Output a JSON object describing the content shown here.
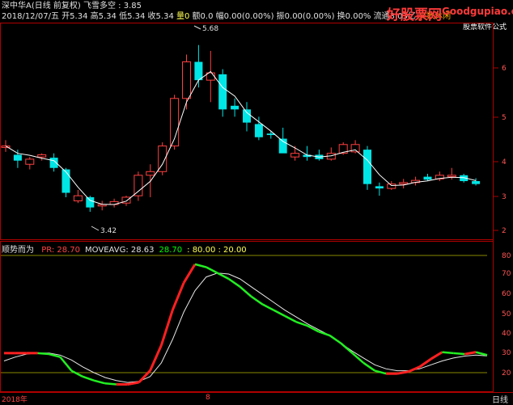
{
  "header": {
    "row1": [
      {
        "text": "深中华A(日线 前复权)",
        "cls": "c-white"
      },
      {
        "text": " 飞雪多空 : 3.85",
        "cls": "c-white"
      }
    ],
    "row2": [
      {
        "text": "2018/12/07/五 ",
        "cls": "c-white"
      },
      {
        "text": "开5.34 ",
        "cls": "c-white"
      },
      {
        "text": "高5.34 ",
        "cls": "c-white"
      },
      {
        "text": "低5.34 ",
        "cls": "c-white"
      },
      {
        "text": "收5.34 ",
        "cls": "c-white"
      },
      {
        "text": "量0 ",
        "cls": "c-yellow"
      },
      {
        "text": "额0.0 ",
        "cls": "c-white"
      },
      {
        "text": "幅0.00(0.00%) ",
        "cls": "c-white"
      },
      {
        "text": "振0.00(0.00%) ",
        "cls": "c-white"
      },
      {
        "text": "换0.00% ",
        "cls": "c-white"
      },
      {
        "text": "流通3.03亿 ",
        "cls": "c-white"
      },
      {
        "text": "文数休闲",
        "cls": "c-orange"
      }
    ]
  },
  "brand": {
    "cn": "好股票网",
    "url": "Goodgupiao.com",
    "sub": "股票软件公式"
  },
  "main_chart": {
    "high_label": "5.68",
    "low_label": "3.42",
    "right_axis": [
      "6",
      "5",
      "4",
      "3",
      "2"
    ]
  },
  "indicator": {
    "name": "顺势而为",
    "items": [
      {
        "text": "PR: 28.70",
        "cls": "c-red"
      },
      {
        "text": "MOVEAVG: 28.63",
        "cls": "c-white"
      },
      {
        "text": "28.70",
        "cls": "c-green"
      },
      {
        "text": ": 80.00 : 20.00",
        "cls": "c-yellow"
      }
    ],
    "right_axis": [
      "80",
      "70",
      "60",
      "50",
      "40",
      "30",
      "20"
    ]
  },
  "footer": {
    "date_left": "2018年",
    "date_mid": "8",
    "day_tab": "日线"
  },
  "colors": {
    "up": "#ff4040",
    "down": "#00e5e5",
    "frame": "#b00000",
    "ma": "#ffffff"
  },
  "chart_data": {
    "type": "candlestick",
    "candles": [
      {
        "o": 4.28,
        "h": 4.38,
        "l": 4.22,
        "c": 4.3,
        "d": false
      },
      {
        "o": 4.18,
        "h": 4.25,
        "l": 4.0,
        "c": 4.1,
        "d": true
      },
      {
        "o": 4.05,
        "h": 4.15,
        "l": 3.98,
        "c": 4.12,
        "d": false
      },
      {
        "o": 4.15,
        "h": 4.2,
        "l": 4.1,
        "c": 4.18,
        "d": false
      },
      {
        "o": 4.14,
        "h": 4.2,
        "l": 3.95,
        "c": 4.0,
        "d": true
      },
      {
        "o": 3.98,
        "h": 4.0,
        "l": 3.6,
        "c": 3.66,
        "d": true
      },
      {
        "o": 3.62,
        "h": 3.7,
        "l": 3.52,
        "c": 3.55,
        "d": false
      },
      {
        "o": 3.6,
        "h": 3.62,
        "l": 3.4,
        "c": 3.46,
        "d": true
      },
      {
        "o": 3.48,
        "h": 3.55,
        "l": 3.42,
        "c": 3.5,
        "d": false
      },
      {
        "o": 3.5,
        "h": 3.58,
        "l": 3.46,
        "c": 3.54,
        "d": false
      },
      {
        "o": 3.52,
        "h": 3.62,
        "l": 3.48,
        "c": 3.6,
        "d": false
      },
      {
        "o": 3.62,
        "h": 3.95,
        "l": 3.55,
        "c": 3.9,
        "d": false
      },
      {
        "o": 3.9,
        "h": 4.05,
        "l": 3.6,
        "c": 3.95,
        "d": false
      },
      {
        "o": 3.95,
        "h": 4.35,
        "l": 3.9,
        "c": 4.3,
        "d": false
      },
      {
        "o": 4.3,
        "h": 5.0,
        "l": 4.25,
        "c": 4.95,
        "d": false
      },
      {
        "o": 4.95,
        "h": 5.55,
        "l": 4.8,
        "c": 5.45,
        "d": false
      },
      {
        "o": 5.45,
        "h": 5.68,
        "l": 5.1,
        "c": 5.2,
        "d": true
      },
      {
        "o": 5.2,
        "h": 5.6,
        "l": 4.9,
        "c": 5.3,
        "d": false
      },
      {
        "o": 5.28,
        "h": 5.35,
        "l": 4.7,
        "c": 4.8,
        "d": true
      },
      {
        "o": 4.8,
        "h": 4.95,
        "l": 4.7,
        "c": 4.85,
        "d": true
      },
      {
        "o": 4.8,
        "h": 4.9,
        "l": 4.5,
        "c": 4.62,
        "d": true
      },
      {
        "o": 4.6,
        "h": 4.7,
        "l": 4.38,
        "c": 4.42,
        "d": true
      },
      {
        "o": 4.45,
        "h": 4.5,
        "l": 4.4,
        "c": 4.47,
        "d": true
      },
      {
        "o": 4.4,
        "h": 4.55,
        "l": 4.3,
        "c": 4.2,
        "d": true
      },
      {
        "o": 4.2,
        "h": 4.3,
        "l": 4.1,
        "c": 4.15,
        "d": false
      },
      {
        "o": 4.15,
        "h": 4.3,
        "l": 4.1,
        "c": 4.18,
        "d": true
      },
      {
        "o": 4.18,
        "h": 4.25,
        "l": 4.1,
        "c": 4.12,
        "d": true
      },
      {
        "o": 4.12,
        "h": 4.28,
        "l": 4.1,
        "c": 4.2,
        "d": false
      },
      {
        "o": 4.2,
        "h": 4.35,
        "l": 4.18,
        "c": 4.32,
        "d": false
      },
      {
        "o": 4.32,
        "h": 4.38,
        "l": 4.2,
        "c": 4.22,
        "d": false
      },
      {
        "o": 4.25,
        "h": 4.3,
        "l": 3.7,
        "c": 3.78,
        "d": true
      },
      {
        "o": 3.75,
        "h": 3.8,
        "l": 3.62,
        "c": 3.72,
        "d": true
      },
      {
        "o": 3.72,
        "h": 3.82,
        "l": 3.7,
        "c": 3.78,
        "d": false
      },
      {
        "o": 3.78,
        "h": 3.85,
        "l": 3.72,
        "c": 3.8,
        "d": false
      },
      {
        "o": 3.8,
        "h": 3.88,
        "l": 3.76,
        "c": 3.83,
        "d": false
      },
      {
        "o": 3.88,
        "h": 3.92,
        "l": 3.82,
        "c": 3.84,
        "d": true
      },
      {
        "o": 3.85,
        "h": 3.95,
        "l": 3.82,
        "c": 3.9,
        "d": false
      },
      {
        "o": 3.9,
        "h": 4.0,
        "l": 3.84,
        "c": 3.88,
        "d": false
      },
      {
        "o": 3.9,
        "h": 3.92,
        "l": 3.8,
        "c": 3.82,
        "d": true
      },
      {
        "o": 3.82,
        "h": 3.86,
        "l": 3.76,
        "c": 3.78,
        "d": true
      }
    ]
  }
}
